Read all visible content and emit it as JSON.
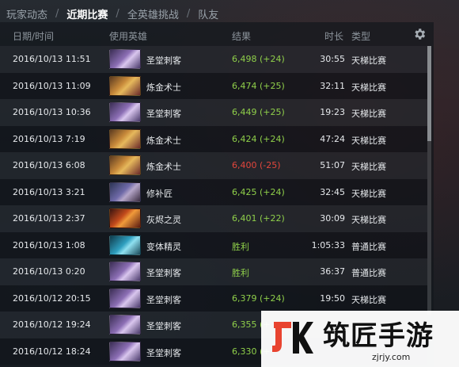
{
  "nav": {
    "tabs": [
      {
        "label": "玩家动态",
        "active": false
      },
      {
        "label": "近期比赛",
        "active": true
      },
      {
        "label": "全英雄挑战",
        "active": false
      },
      {
        "label": "队友",
        "active": false
      }
    ],
    "separator": "/"
  },
  "table": {
    "headers": {
      "date": "日期/时间",
      "hero": "使用英雄",
      "result": "结果",
      "duration": "时长",
      "type": "类型"
    },
    "settings_icon": "gear-icon",
    "rows": [
      {
        "date": "2016/10/13 11:51",
        "hero": "圣堂刺客",
        "hero_icon": "templar-assassin-portrait",
        "result": "6,498 (+24)",
        "result_status": "win",
        "duration": "30:55",
        "type": "天梯比赛"
      },
      {
        "date": "2016/10/13 11:09",
        "hero": "炼金术士",
        "hero_icon": "alchemist-portrait",
        "result": "6,474 (+25)",
        "result_status": "win",
        "duration": "32:11",
        "type": "天梯比赛"
      },
      {
        "date": "2016/10/13 10:36",
        "hero": "圣堂刺客",
        "hero_icon": "templar-assassin-portrait",
        "result": "6,449 (+25)",
        "result_status": "win",
        "duration": "19:23",
        "type": "天梯比赛"
      },
      {
        "date": "2016/10/13 7:19",
        "hero": "炼金术士",
        "hero_icon": "alchemist-portrait",
        "result": "6,424 (+24)",
        "result_status": "win",
        "duration": "47:24",
        "type": "天梯比赛"
      },
      {
        "date": "2016/10/13 6:08",
        "hero": "炼金术士",
        "hero_icon": "alchemist-portrait",
        "result": "6,400 (-25)",
        "result_status": "loss",
        "duration": "51:07",
        "type": "天梯比赛"
      },
      {
        "date": "2016/10/13 3:21",
        "hero": "修补匠",
        "hero_icon": "tinker-portrait",
        "result": "6,425 (+24)",
        "result_status": "win",
        "duration": "32:45",
        "type": "天梯比赛"
      },
      {
        "date": "2016/10/13 2:37",
        "hero": "灰烬之灵",
        "hero_icon": "ember-spirit-portrait",
        "result": "6,401 (+22)",
        "result_status": "win",
        "duration": "30:09",
        "type": "天梯比赛"
      },
      {
        "date": "2016/10/13 1:08",
        "hero": "变体精灵",
        "hero_icon": "morphling-portrait",
        "result": "胜利",
        "result_status": "win",
        "duration": "1:05:33",
        "type": "普通比赛"
      },
      {
        "date": "2016/10/13 0:20",
        "hero": "圣堂刺客",
        "hero_icon": "templar-assassin-portrait",
        "result": "胜利",
        "result_status": "win",
        "duration": "36:37",
        "type": "普通比赛"
      },
      {
        "date": "2016/10/12 20:15",
        "hero": "圣堂刺客",
        "hero_icon": "templar-assassin-portrait",
        "result": "6,379 (+24)",
        "result_status": "win",
        "duration": "19:50",
        "type": "天梯比赛"
      },
      {
        "date": "2016/10/12 19:24",
        "hero": "圣堂刺客",
        "hero_icon": "templar-assassin-portrait",
        "result": "6,355 (+",
        "result_status": "win",
        "duration": "",
        "type": ""
      },
      {
        "date": "2016/10/12 18:24",
        "hero": "圣堂刺客",
        "hero_icon": "templar-assassin-portrait",
        "result": "6,330 (+",
        "result_status": "win",
        "duration": "",
        "type": ""
      }
    ]
  },
  "colors": {
    "win": "#8fcf4a",
    "loss": "#e2463c",
    "watermark_accent": "#e8432f"
  },
  "watermark": {
    "logo_letters": "JK",
    "title": "筑匠手游",
    "url": "zjrjy.com"
  }
}
